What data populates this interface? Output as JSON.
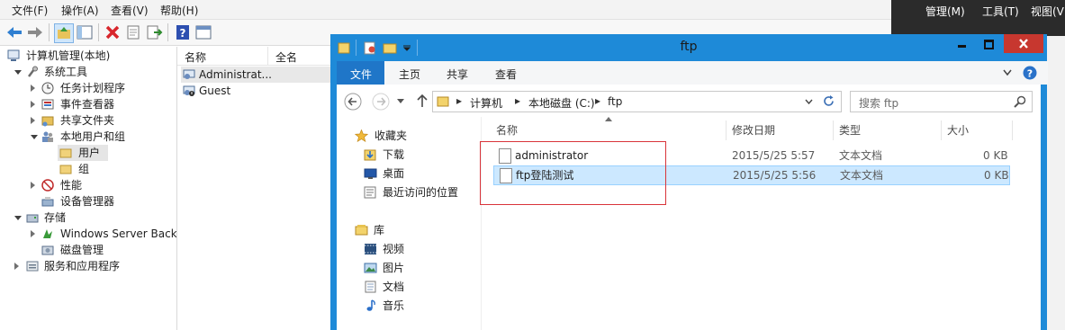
{
  "mmc": {
    "menu": [
      "文件(F)",
      "操作(A)",
      "查看(V)",
      "帮助(H)"
    ],
    "tree": {
      "root": "计算机管理(本地)",
      "system_tools": "系统工具",
      "task_scheduler": "任务计划程序",
      "event_viewer": "事件查看器",
      "shared_folders": "共享文件夹",
      "local_users": "本地用户和组",
      "users": "用户",
      "groups": "组",
      "performance": "性能",
      "device_manager": "设备管理器",
      "storage": "存储",
      "windows_backup": "Windows Server Back",
      "disk_management": "磁盘管理",
      "services_apps": "服务和应用程序"
    },
    "list": {
      "col_name": "名称",
      "col_fullname": "全名",
      "rows": [
        "Administrat...",
        "Guest"
      ]
    }
  },
  "dark_menu": [
    "管理(M)",
    "工具(T)",
    "视图(V"
  ],
  "explorer": {
    "title": "ftp",
    "ribbon_tabs": [
      "文件",
      "主页",
      "共享",
      "查看"
    ],
    "breadcrumb": [
      "计算机",
      "本地磁盘 (C:)",
      "ftp"
    ],
    "search_placeholder": "搜索 ftp",
    "nav": {
      "favorites": "收藏夹",
      "downloads": "下载",
      "desktop": "桌面",
      "recent": "最近访问的位置",
      "libraries": "库",
      "videos": "视频",
      "pictures": "图片",
      "documents": "文档",
      "music": "音乐"
    },
    "columns": [
      "名称",
      "修改日期",
      "类型",
      "大小"
    ],
    "files": [
      {
        "name": "administrator",
        "date": "2015/5/25 5:57",
        "type": "文本文档",
        "size": "0 KB"
      },
      {
        "name": "ftp登陆测试",
        "date": "2015/5/25 5:56",
        "type": "文本文档",
        "size": "0 KB"
      }
    ]
  },
  "colors": {
    "explorer_frame": "#1e8ad8",
    "close_button": "#c7372f",
    "selection": "#cce8ff",
    "annotation_red": "#d9343a"
  }
}
